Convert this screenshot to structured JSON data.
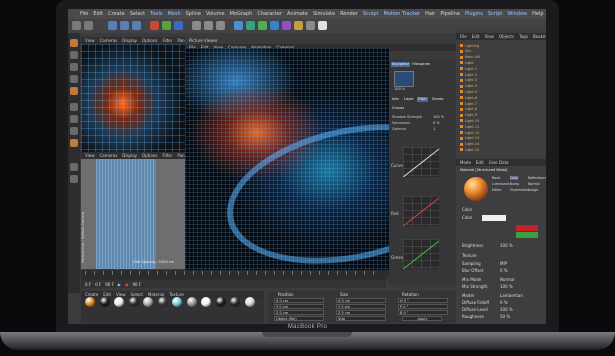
{
  "device": {
    "brand_label": "MacBook Pro"
  },
  "menubar": {
    "items": [
      "File",
      "Edit",
      "Create",
      "Select",
      "Tools",
      "Mesh",
      "Spline",
      "Volume",
      "MoGraph",
      "Character",
      "Animate",
      "Simulate",
      "Render",
      "Sculpt",
      "Motion Tracker",
      "Hair",
      "Pipeline",
      "Plugins",
      "Script",
      "Window",
      "Help"
    ],
    "highlight": [
      "Tools",
      "Mesh",
      "Sculpt",
      "Motion Tracker",
      "Plugins",
      "Script",
      "Window"
    ]
  },
  "top_left_viewport": {
    "menu": [
      "View",
      "Cameras",
      "Display",
      "Options",
      "Filter",
      "Panel"
    ]
  },
  "bottom_left_viewport": {
    "menu": [
      "View",
      "Cameras",
      "Display",
      "Options",
      "Filter",
      "Panel"
    ],
    "side_label": "Perspective / Default Camera",
    "grid_label": "Grid Spacing : 1000 cm"
  },
  "picture_viewer": {
    "title": "Picture Viewer",
    "menu": [
      "File",
      "Edit",
      "View",
      "Compare",
      "Animation",
      "Cameras"
    ],
    "status": "00:00:30  Size: 2000x2000, RGB (8 Bit), 11.45 MB"
  },
  "picture_viewer_side": {
    "tabs": [
      "Navigator",
      "Histogram"
    ],
    "zoom": "100 %",
    "sub_tabs": [
      "Info",
      "Layer",
      "Filter",
      "Stereo"
    ],
    "filter_title": "Curves",
    "controls": [
      "Shadow Strength",
      "Saturation",
      "Gamma"
    ],
    "values": [
      "100 %",
      "0 %",
      "1"
    ],
    "curve_labels": [
      "Curve",
      "Red",
      "Green"
    ]
  },
  "right_panel": {
    "menu": [
      "File",
      "Edit",
      "View",
      "Objects",
      "Tags",
      "Bookmarks"
    ],
    "objects": [
      "Lighting",
      "Sky",
      "Main Lift",
      "Light",
      "Light.1",
      "Light.2",
      "Light.3",
      "Light.4",
      "Light.5",
      "Light.6",
      "Light.7",
      "Light.8",
      "Light.9",
      "Light.10",
      "Light.11",
      "Light.12",
      "Light.13",
      "Light.14",
      "Light.15"
    ],
    "attributes_menu": [
      "Mode",
      "Edit",
      "User Data"
    ],
    "material_title": "Material [Structured Metal]",
    "attr_tabs": [
      "Basic",
      "Color",
      "Reflectance",
      "Luminance",
      "Bump",
      "Normal",
      "Editor",
      "Illumination",
      "Assign"
    ],
    "color_label": "Color",
    "color_field": "Color",
    "brightness_label": "Brightness",
    "brightness_value": "100 %",
    "texture_label": "Texture",
    "mix_mode_label": "Mix Mode",
    "mix_mode_value": "Normal",
    "mix_strength_label": "Mix Strength",
    "mix_strength_value": "100 %",
    "model_label": "Model",
    "model_value": "Lambertian",
    "diffuse_falloff_label": "Diffuse Falloff",
    "diffuse_falloff_value": "0 %",
    "diffuse_level_label": "Diffuse Level",
    "diffuse_level_value": "100 %",
    "roughness_label": "Roughness",
    "roughness_value": "50 %",
    "sampling_label": "Sampling",
    "sampling_value": "MIP",
    "blur_label": "Blur Offset",
    "blur_value": "0 %",
    "colors": {
      "accent": "#e08a2a",
      "swatch_red": "#c8202a",
      "swatch_green": "#3aa040"
    }
  },
  "timeline": {
    "start": "0 F",
    "end": "90 F",
    "current": "0 F",
    "fps": "90 F"
  },
  "material_manager": {
    "menu": [
      "Create",
      "Edit",
      "View",
      "Select",
      "Material",
      "Texture"
    ]
  },
  "coordinates": {
    "headers": [
      "Position",
      "Size",
      "Rotation"
    ],
    "fields": [
      "X  0 cm",
      "Y  0 cm",
      "Z  0 cm",
      "X  0 cm",
      "Y  0 cm",
      "Z  0 cm",
      "H  0 °",
      "P  0 °",
      "B  0 °"
    ],
    "mode": "Object (Rel)",
    "size_mode": "Size",
    "apply_label": "Apply"
  }
}
